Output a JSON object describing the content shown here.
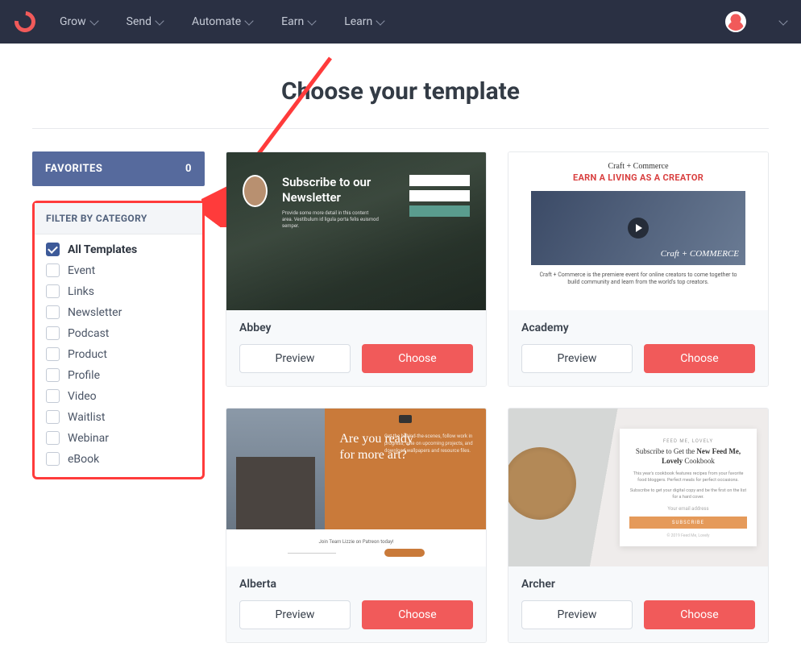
{
  "nav": {
    "items": [
      "Grow",
      "Send",
      "Automate",
      "Earn",
      "Learn"
    ]
  },
  "page": {
    "title": "Choose your template"
  },
  "sidebar": {
    "favorites_label": "FAVORITES",
    "favorites_count": "0",
    "filter_heading": "FILTER BY CATEGORY",
    "categories": [
      {
        "label": "All Templates",
        "checked": true
      },
      {
        "label": "Event",
        "checked": false
      },
      {
        "label": "Links",
        "checked": false
      },
      {
        "label": "Newsletter",
        "checked": false
      },
      {
        "label": "Podcast",
        "checked": false
      },
      {
        "label": "Product",
        "checked": false
      },
      {
        "label": "Profile",
        "checked": false
      },
      {
        "label": "Video",
        "checked": false
      },
      {
        "label": "Waitlist",
        "checked": false
      },
      {
        "label": "Webinar",
        "checked": false
      },
      {
        "label": "eBook",
        "checked": false
      }
    ]
  },
  "templates": [
    {
      "name": "Abbey",
      "preview_label": "Preview",
      "choose_label": "Choose",
      "thumb": {
        "headline": "Subscribe to our Newsletter"
      }
    },
    {
      "name": "Academy",
      "preview_label": "Preview",
      "choose_label": "Choose",
      "thumb": {
        "line1": "Craft + Commerce",
        "line2": "EARN A LIVING AS A CREATOR",
        "badge": "Craft + COMMERCE",
        "caption": "Craft + Commerce is the premiere event for online creators to come together to build community and learn from the world's top creators."
      }
    },
    {
      "name": "Alberta",
      "preview_label": "Preview",
      "choose_label": "Choose",
      "thumb": {
        "headline": "Are you ready for more art?",
        "bar_text": "Join Team Lizzie on Patreon today!"
      }
    },
    {
      "name": "Archer",
      "preview_label": "Preview",
      "choose_label": "Choose",
      "thumb": {
        "eyebrow": "FEED ME, LOVELY",
        "heading_pre": "Subscribe to Get the ",
        "heading_strong": "New Feed Me, Lovely",
        "heading_post": " Cookbook",
        "email_placeholder": "Your email address",
        "button": "SUBSCRIBE"
      }
    }
  ]
}
